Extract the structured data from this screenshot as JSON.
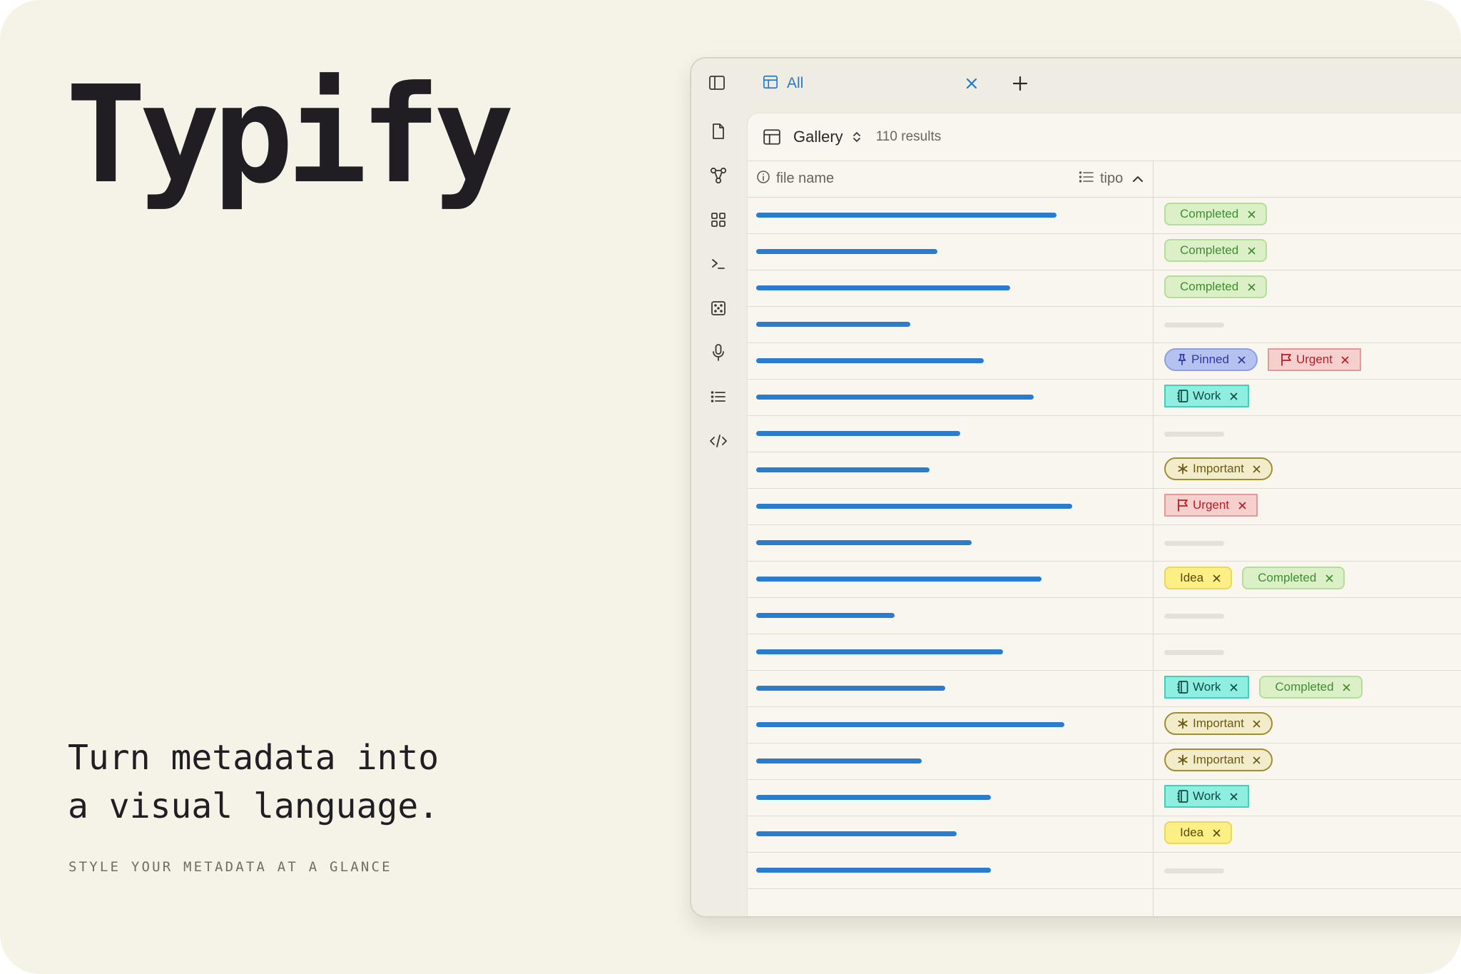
{
  "brand": {
    "title": "Typify"
  },
  "tagline": {
    "line1": "Turn metadata into",
    "line2": "a visual language.",
    "sub": "STYLE YOUR METADATA AT A GLANCE"
  },
  "colors": {
    "background": "#f5f2e8",
    "accent": "#2479cf",
    "text": "#211e23"
  },
  "app": {
    "tab": {
      "label": "All",
      "icon": "table-icon"
    },
    "rail_icons": [
      "file-icon",
      "graph-icon",
      "grid-icon",
      "terminal-icon",
      "dice-icon",
      "microphone-icon",
      "list-icon",
      "code-icon"
    ],
    "view": {
      "name": "Gallery",
      "results": "110 results"
    },
    "columns": {
      "file_name": "file name",
      "tipo": "tipo"
    },
    "tag_styles": {
      "Completed": {
        "icon": null,
        "style": "completed"
      },
      "Pinned": {
        "icon": "pin-icon",
        "style": "pinned"
      },
      "Urgent": {
        "icon": "flag-icon",
        "style": "urgent"
      },
      "Work": {
        "icon": "notebook-icon",
        "style": "work"
      },
      "Important": {
        "icon": "asterisk-icon",
        "style": "important"
      },
      "Idea": {
        "icon": null,
        "style": "idea"
      }
    },
    "rows": [
      {
        "name_fill": 0.78,
        "tags": [
          "Completed"
        ]
      },
      {
        "name_fill": 0.47,
        "tags": [
          "Completed"
        ]
      },
      {
        "name_fill": 0.66,
        "tags": [
          "Completed"
        ]
      },
      {
        "name_fill": 0.4,
        "tags": []
      },
      {
        "name_fill": 0.59,
        "tags": [
          "Pinned",
          "Urgent"
        ]
      },
      {
        "name_fill": 0.72,
        "tags": [
          "Work"
        ]
      },
      {
        "name_fill": 0.53,
        "tags": []
      },
      {
        "name_fill": 0.45,
        "tags": [
          "Important"
        ]
      },
      {
        "name_fill": 0.82,
        "tags": [
          "Urgent"
        ]
      },
      {
        "name_fill": 0.56,
        "tags": []
      },
      {
        "name_fill": 0.74,
        "tags": [
          "Idea",
          "Completed"
        ]
      },
      {
        "name_fill": 0.36,
        "tags": []
      },
      {
        "name_fill": 0.64,
        "tags": []
      },
      {
        "name_fill": 0.49,
        "tags": [
          "Work",
          "Completed"
        ]
      },
      {
        "name_fill": 0.8,
        "tags": [
          "Important"
        ]
      },
      {
        "name_fill": 0.43,
        "tags": [
          "Important"
        ]
      },
      {
        "name_fill": 0.61,
        "tags": [
          "Work"
        ]
      },
      {
        "name_fill": 0.52,
        "tags": [
          "Idea"
        ]
      },
      {
        "name_fill": 0.61,
        "tags": []
      }
    ]
  }
}
